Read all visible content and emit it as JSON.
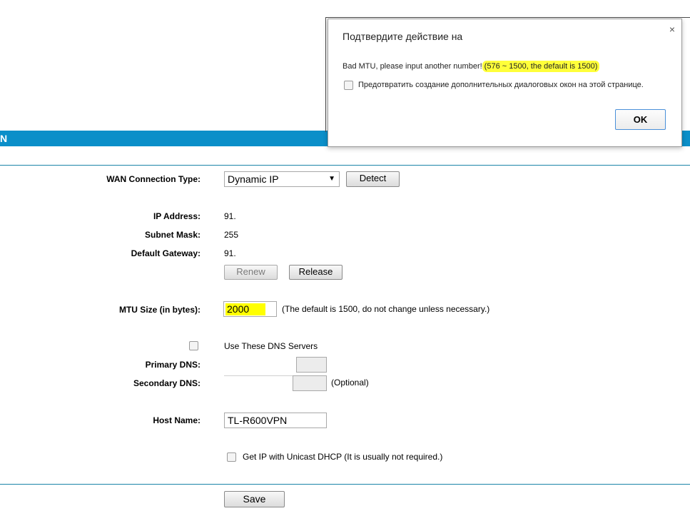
{
  "header": {
    "banner_text": "N"
  },
  "dialog": {
    "title": "Подтвердите действие на",
    "close_glyph": "×",
    "message_prefix": "Bad MTU, please input another number!",
    "message_highlight": "(576 ~ 1500, the default is 1500)",
    "suppress_label": "Предотвратить создание дополнительных диалоговых окон на этой странице.",
    "suppress_checked": false,
    "ok_label": "OK"
  },
  "form": {
    "wan_type_label": "WAN Connection Type:",
    "wan_type_value": "Dynamic IP",
    "detect_label": "Detect",
    "ip_label": "IP Address:",
    "ip_value": "91.",
    "mask_label": "Subnet Mask:",
    "mask_value": "255",
    "gateway_label": "Default Gateway:",
    "gateway_value": "91.",
    "renew_label": "Renew",
    "release_label": "Release",
    "mtu_label": "MTU Size (in bytes):",
    "mtu_value": "2000",
    "mtu_hint": "(The default is 1500, do not change unless necessary.)",
    "use_dns_label": "Use These DNS Servers",
    "use_dns_checked": false,
    "primary_dns_label": "Primary DNS:",
    "primary_dns_value": "",
    "secondary_dns_label": "Secondary DNS:",
    "secondary_dns_value": "",
    "optional_label": "(Optional)",
    "host_label": "Host Name:",
    "host_value": "TL-R600VPN",
    "unicast_label": "Get IP with Unicast DHCP (It is usually not required.)",
    "unicast_checked": false,
    "save_label": "Save"
  },
  "colors": {
    "banner": "#0b8fc9",
    "highlight": "#ffff00",
    "ok_border": "#4a90d9"
  }
}
